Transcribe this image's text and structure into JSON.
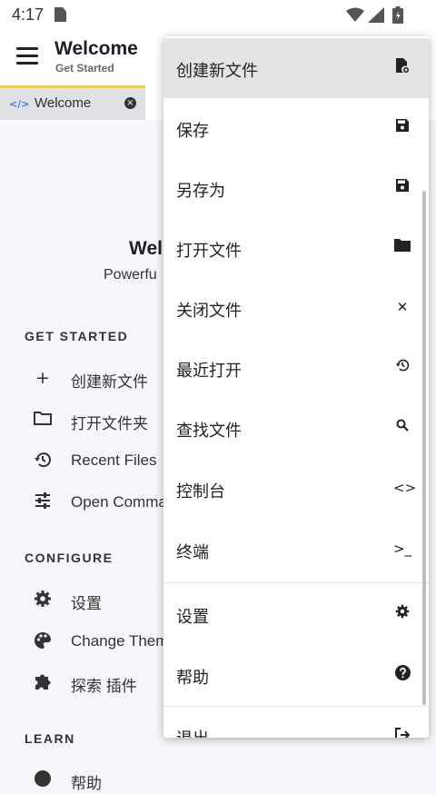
{
  "status": {
    "time": "4:17"
  },
  "appbar": {
    "title": "Welcome",
    "subtitle": "Get Started"
  },
  "tab": {
    "label": "Welcome",
    "icon": "</>",
    "close": "×"
  },
  "welcome": {
    "heading": "Wel",
    "sub": "Powerfu"
  },
  "sections": {
    "get_started": "GET STARTED",
    "configure": "CONFIGURE",
    "learn": "LEARN"
  },
  "items": {
    "new_file": {
      "icon": "+",
      "label": "创建新文件"
    },
    "open_folder": {
      "icon": "folder-icon",
      "label": "打开文件夹"
    },
    "recent_files": {
      "icon": "history-icon",
      "label": "Recent Files"
    },
    "open_command": {
      "icon": "tune-icon",
      "label": "Open Comma"
    },
    "settings": {
      "icon": "gear-icon",
      "label": "设置"
    },
    "change_theme": {
      "icon": "palette-icon",
      "label": "Change Them"
    },
    "plugins": {
      "icon": "puzzle-icon",
      "label": "探索 插件"
    },
    "help": {
      "icon": "help-icon",
      "label": "帮助"
    }
  },
  "menu": {
    "items": [
      {
        "label": "创建新文件",
        "icon": "new-file-icon"
      },
      {
        "label": "保存",
        "icon": "save-icon"
      },
      {
        "label": "另存为",
        "icon": "save-as-icon"
      },
      {
        "label": "打开文件",
        "icon": "folder-icon"
      },
      {
        "label": "关闭文件",
        "icon": "close-icon"
      },
      {
        "label": "最近打开",
        "icon": "history-icon"
      },
      {
        "label": "查找文件",
        "icon": "search-icon"
      },
      {
        "label": "控制台",
        "icon": "code-icon"
      },
      {
        "label": "终端",
        "icon": "terminal-icon"
      },
      {
        "label": "设置",
        "icon": "gear-icon"
      },
      {
        "label": "帮助",
        "icon": "help-icon"
      },
      {
        "label": "退出",
        "icon": "exit-icon"
      }
    ],
    "glyphs": {
      "close": "✕",
      "code": "<>",
      "terminal": ">_",
      "help": "?",
      "search": "⚲",
      "history": "↺",
      "gear": "⚙"
    }
  }
}
